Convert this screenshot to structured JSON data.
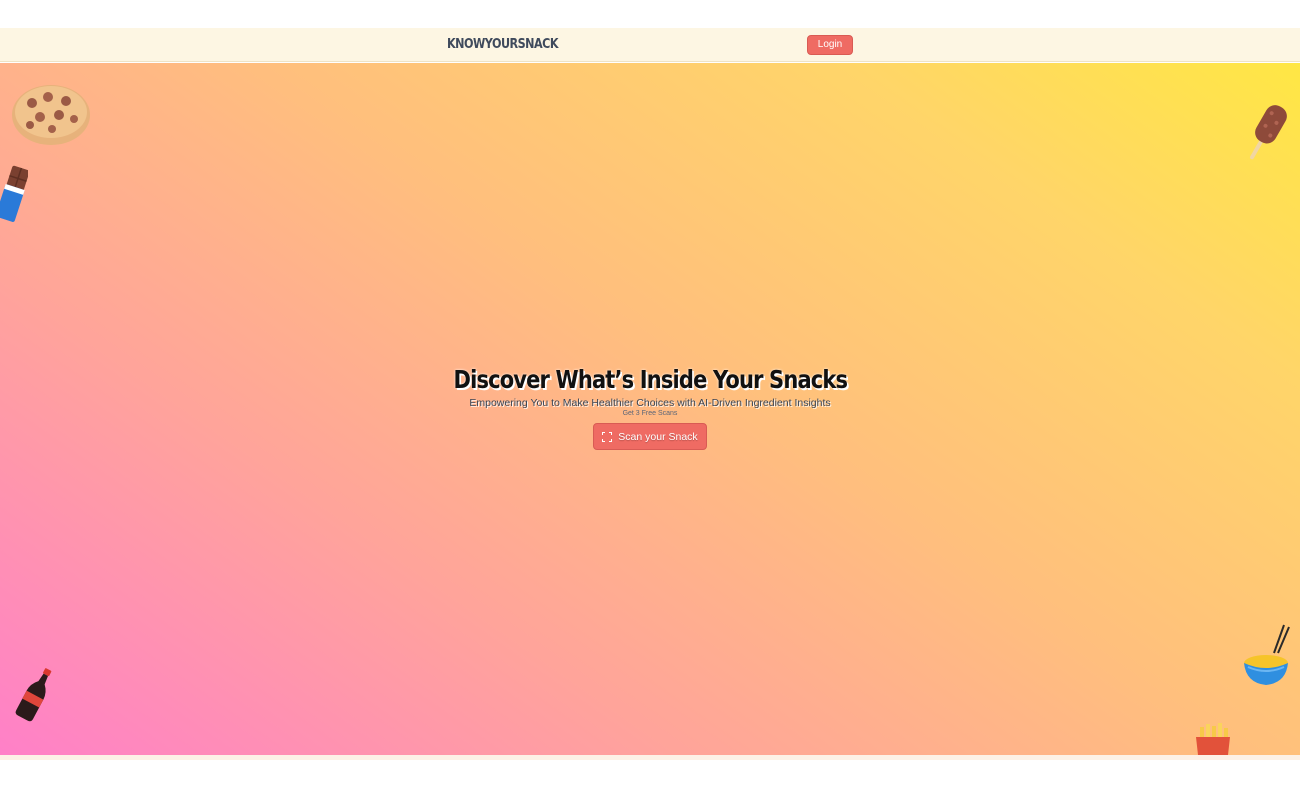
{
  "nav": {
    "brand": "KNOWYOURSNACK",
    "login_label": "Login"
  },
  "hero": {
    "title": "Discover What’s Inside Your Snacks",
    "subtitle": "Empowering You to Make Healthier Choices with AI-Driven Ingredient Insights",
    "free_scans": "Get 3 Free Scans",
    "scan_button_label": "Scan your Snack",
    "scan_button_icon": "scan-frame-icon"
  },
  "decorations": [
    "cookie-icon",
    "chocolate-bar-icon",
    "popsicle-icon",
    "cola-bottle-icon",
    "noodle-bowl-icon",
    "fries-icon"
  ],
  "colors": {
    "nav_bg": "#fdf6e3",
    "accent": "#ef6b63",
    "gradient_start": "#ff80c8",
    "gradient_mid": "#ffbf7d",
    "gradient_end": "#ffe744",
    "brand_text": "#3f4a5c"
  }
}
